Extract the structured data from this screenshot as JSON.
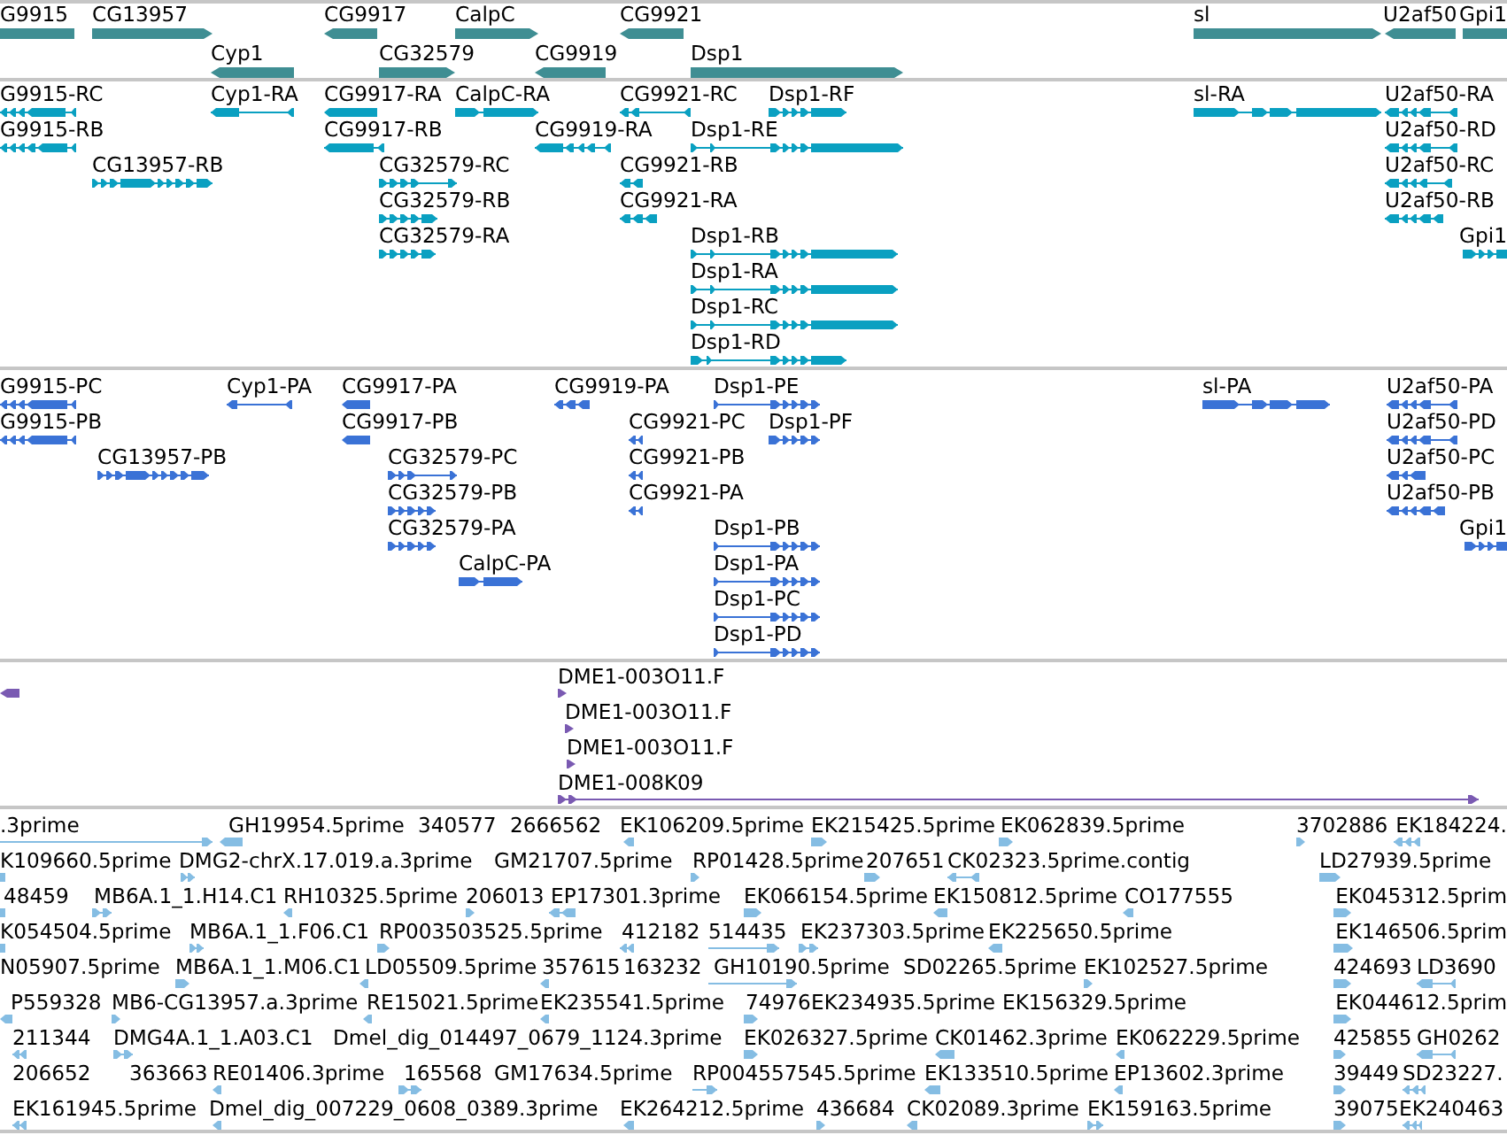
{
  "tracks": [
    {
      "kind": "gene",
      "rows": [
        {
          "features": [
            {
              "label": "G9915",
              "reverse": true
            },
            {
              "label": "CG13957",
              "reverse": false
            },
            {
              "label": "CG9917",
              "reverse": true
            },
            {
              "label": "CalpC",
              "reverse": false
            },
            {
              "label": "CG9921",
              "reverse": true
            },
            {
              "label": "sl",
              "reverse": false
            },
            {
              "label": "U2af50",
              "reverse": true
            },
            {
              "label": "Gpi1",
              "reverse": false
            }
          ]
        },
        {
          "features": [
            {
              "label": "Cyp1",
              "reverse": true
            },
            {
              "label": "CG32579",
              "reverse": false
            },
            {
              "label": "CG9919",
              "reverse": true
            },
            {
              "label": "Dsp1",
              "reverse": false
            }
          ]
        }
      ]
    },
    {
      "kind": "transcript",
      "rows": [
        {
          "features": [
            {
              "label": "G9915-RC",
              "reverse": true
            },
            {
              "label": "Cyp1-RA",
              "reverse": true
            },
            {
              "label": "CG9917-RA",
              "reverse": true
            },
            {
              "label": "CalpC-RA",
              "reverse": false
            },
            {
              "label": "CG9921-RC",
              "reverse": true
            },
            {
              "label": "Dsp1-RF",
              "reverse": false
            },
            {
              "label": "sl-RA",
              "reverse": false
            },
            {
              "label": "U2af50-RA",
              "reverse": true
            }
          ]
        },
        {
          "features": [
            {
              "label": "G9915-RB",
              "reverse": true
            },
            {
              "label": "CG9917-RB",
              "reverse": true
            },
            {
              "label": "CG9919-RA",
              "reverse": true
            },
            {
              "label": "Dsp1-RE",
              "reverse": false
            },
            {
              "label": "U2af50-RD",
              "reverse": true
            }
          ]
        },
        {
          "features": [
            {
              "label": "CG13957-RB",
              "reverse": false
            },
            {
              "label": "CG32579-RC",
              "reverse": false
            },
            {
              "label": "CG9921-RB",
              "reverse": true
            },
            {
              "label": "U2af50-RC",
              "reverse": true
            }
          ]
        },
        {
          "features": [
            {
              "label": "CG32579-RB",
              "reverse": false
            },
            {
              "label": "CG9921-RA",
              "reverse": true
            },
            {
              "label": "U2af50-RB",
              "reverse": true
            }
          ]
        },
        {
          "features": [
            {
              "label": "CG32579-RA",
              "reverse": false
            },
            {
              "label": "Dsp1-RB",
              "reverse": false
            },
            {
              "label": "Gpi1",
              "reverse": false
            }
          ]
        },
        {
          "features": [
            {
              "label": "Dsp1-RA",
              "reverse": false
            }
          ]
        },
        {
          "features": [
            {
              "label": "Dsp1-RC",
              "reverse": false
            }
          ]
        },
        {
          "features": [
            {
              "label": "Dsp1-RD",
              "reverse": false
            }
          ]
        }
      ]
    },
    {
      "kind": "protein",
      "rows": [
        {
          "features": [
            {
              "label": "G9915-PC",
              "reverse": true
            },
            {
              "label": "Cyp1-PA",
              "reverse": true
            },
            {
              "label": "CG9917-PA",
              "reverse": true
            },
            {
              "label": "CG9919-PA",
              "reverse": true
            },
            {
              "label": "Dsp1-PE",
              "reverse": false
            },
            {
              "label": "sl-PA",
              "reverse": false
            },
            {
              "label": "U2af50-PA",
              "reverse": true
            }
          ]
        },
        {
          "features": [
            {
              "label": "G9915-PB",
              "reverse": true
            },
            {
              "label": "CG9917-PB",
              "reverse": true
            },
            {
              "label": "CG9921-PC",
              "reverse": true
            },
            {
              "label": "Dsp1-PF",
              "reverse": false
            },
            {
              "label": "U2af50-PD",
              "reverse": true
            }
          ]
        },
        {
          "features": [
            {
              "label": "CG13957-PB",
              "reverse": false
            },
            {
              "label": "CG32579-PC",
              "reverse": false
            },
            {
              "label": "CG9921-PB",
              "reverse": true
            },
            {
              "label": "U2af50-PC",
              "reverse": true
            }
          ]
        },
        {
          "features": [
            {
              "label": "CG32579-PB",
              "reverse": false
            },
            {
              "label": "CG9921-PA",
              "reverse": true
            },
            {
              "label": "U2af50-PB",
              "reverse": true
            }
          ]
        },
        {
          "features": [
            {
              "label": "CG32579-PA",
              "reverse": false
            },
            {
              "label": "Dsp1-PB",
              "reverse": false
            },
            {
              "label": "Gpi1",
              "reverse": false
            }
          ]
        },
        {
          "features": [
            {
              "label": "CalpC-PA",
              "reverse": false
            },
            {
              "label": "Dsp1-PA",
              "reverse": false
            }
          ]
        },
        {
          "features": [
            {
              "label": "Dsp1-PC",
              "reverse": false
            }
          ]
        },
        {
          "features": [
            {
              "label": "Dsp1-PD",
              "reverse": false
            }
          ]
        }
      ]
    },
    {
      "kind": "clone",
      "rows": [
        {
          "features": [
            {
              "reverse": true
            },
            {
              "label": "DME1-003O11.F",
              "reverse": false
            }
          ]
        },
        {
          "features": [
            {
              "label": "DME1-003O11.F",
              "reverse": false
            }
          ]
        },
        {
          "features": [
            {
              "label": "DME1-003O11.F",
              "reverse": false
            }
          ]
        },
        {
          "features": [
            {
              "label": "DME1-008K09",
              "reverse": false
            }
          ]
        }
      ]
    },
    {
      "kind": "est",
      "rows": [
        {
          "features": [
            {
              "label": ".3prime",
              "reverse": false
            },
            {
              "label": "GH19954.5prime",
              "reverse": true
            },
            {
              "label": "340577"
            },
            {
              "label": "2666562"
            },
            {
              "label": "EK106209.5prime",
              "reverse": true
            },
            {
              "label": "EK215425.5prime",
              "reverse": false
            },
            {
              "label": "EK062839.5prime",
              "reverse": false
            },
            {
              "label": "3702886",
              "reverse": false
            },
            {
              "label": "EK184224.",
              "reverse": true
            }
          ]
        },
        {
          "features": [
            {
              "label": "K109660.5prime"
            },
            {
              "label": "DMG2-chrX.17.019.a.3prime",
              "reverse": false
            },
            {
              "label": "GM21707.5prime"
            },
            {
              "label": "RP01428.5prime",
              "reverse": false
            },
            {
              "label": "207651",
              "reverse": false
            },
            {
              "label": "CK02323.5prime.contig",
              "reverse": true
            },
            {
              "label": "LD27939.5prime",
              "reverse": false
            }
          ]
        },
        {
          "features": [
            {
              "label": "48459"
            },
            {
              "label": "MB6A.1_1.H14.C1",
              "reverse": false
            },
            {
              "label": "RH10325.5prime",
              "reverse": true
            },
            {
              "label": "206013",
              "reverse": false
            },
            {
              "label": "EP17301.3prime",
              "reverse": true
            },
            {
              "label": "EK066154.5prime",
              "reverse": false
            },
            {
              "label": "EK150812.5prime",
              "reverse": true
            },
            {
              "label": "CO177555",
              "reverse": true
            },
            {
              "label": "EK045312.5prim",
              "reverse": false
            }
          ]
        },
        {
          "features": [
            {
              "label": "K054504.5prime"
            },
            {
              "label": "MB6A.1_1.F06.C1",
              "reverse": false
            },
            {
              "label": "RP003503525.5prime",
              "reverse": false
            },
            {
              "label": "412182",
              "reverse": true
            },
            {
              "label": "514435",
              "reverse": false
            },
            {
              "label": "EK237303.5prime",
              "reverse": false
            },
            {
              "label": "EK225650.5prime",
              "reverse": true
            },
            {
              "label": "EK146506.5prim",
              "reverse": false
            }
          ]
        },
        {
          "features": [
            {
              "label": "N05907.5prime"
            },
            {
              "label": "MB6A.1_1.M06.C1",
              "reverse": false
            },
            {
              "label": "LD05509.5prime",
              "reverse": true
            },
            {
              "label": "357615",
              "reverse": true
            },
            {
              "label": "163232"
            },
            {
              "label": "GH10190.5prime",
              "reverse": false
            },
            {
              "label": "SD02265.5prime"
            },
            {
              "label": "EK102527.5prime",
              "reverse": false
            },
            {
              "label": "424693",
              "reverse": false
            },
            {
              "label": "LD3690",
              "reverse": true
            }
          ]
        },
        {
          "features": [
            {
              "label": "P559328",
              "reverse": true
            },
            {
              "label": "MB6-CG13957.a.3prime",
              "reverse": false
            },
            {
              "label": "RE15021.5prime",
              "reverse": true
            },
            {
              "label": "EK235541.5prime",
              "reverse": true
            },
            {
              "label": "74976",
              "reverse": false
            },
            {
              "label": "EK234935.5prime"
            },
            {
              "label": "EK156329.5prime"
            },
            {
              "label": "EK044612.5prim",
              "reverse": false
            }
          ]
        },
        {
          "features": [
            {
              "label": "211344",
              "reverse": true
            },
            {
              "label": "DMG4A.1_1.A03.C1",
              "reverse": false
            },
            {
              "label": "Dmel_dig_014497_0679_1124.3prime"
            },
            {
              "label": "EK026327.5prime",
              "reverse": false
            },
            {
              "label": "CK01462.3prime",
              "reverse": true
            },
            {
              "label": "EK062229.5prime",
              "reverse": true
            },
            {
              "label": "425855",
              "reverse": false
            },
            {
              "label": "GH0262",
              "reverse": true
            }
          ]
        },
        {
          "features": [
            {
              "label": "206652"
            },
            {
              "label": "363663"
            },
            {
              "label": "RE01406.3prime",
              "reverse": true
            },
            {
              "label": "165568",
              "reverse": false
            },
            {
              "label": "GM17634.5prime"
            },
            {
              "label": "RP004557545.5prime",
              "reverse": false
            },
            {
              "label": "EK133510.5prime",
              "reverse": true
            },
            {
              "label": "EP13602.3prime",
              "reverse": true
            },
            {
              "label": "39449",
              "reverse": false
            },
            {
              "label": "SD23227.",
              "reverse": true
            }
          ]
        },
        {
          "features": [
            {
              "label": "EK161945.5prime",
              "reverse": true
            },
            {
              "label": "Dmel_dig_007229_0608_0389.3prime",
              "reverse": true
            },
            {
              "label": "EK264212.5prime",
              "reverse": true
            },
            {
              "label": "436684",
              "reverse": false
            },
            {
              "label": "CK02089.3prime",
              "reverse": true
            },
            {
              "label": "EK159163.5prime",
              "reverse": false
            },
            {
              "label": "39075",
              "reverse": false
            },
            {
              "label": "EK240463",
              "reverse": true
            }
          ]
        }
      ]
    }
  ]
}
